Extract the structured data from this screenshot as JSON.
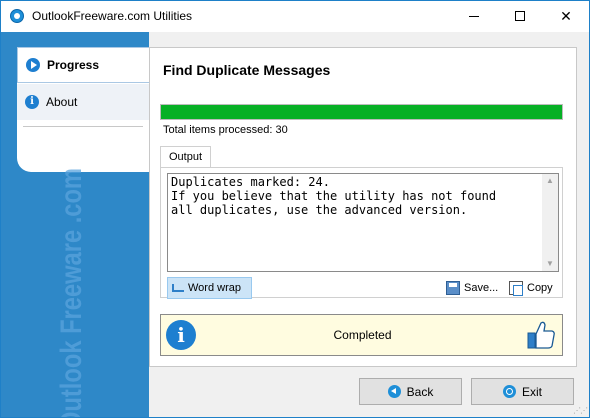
{
  "window": {
    "title": "OutlookFreeware.com Utilities"
  },
  "sidebar": {
    "items": [
      {
        "label": "Progress",
        "icon": "play-icon",
        "active": true
      },
      {
        "label": "About",
        "icon": "info-icon",
        "active": false
      }
    ],
    "watermark": "Outlook Freeware .com"
  },
  "main": {
    "title": "Find Duplicate Messages",
    "progress_percent": 100,
    "progress_color": "#06b025",
    "processed_text": "Total items processed: 30",
    "output_tab": "Output",
    "output_text": "Duplicates marked: 24.\nIf you believe that the utility has not found\nall duplicates, use the advanced version.",
    "toolbar": {
      "word_wrap": "Word wrap",
      "save": "Save...",
      "copy": "Copy"
    },
    "status": {
      "text": "Completed",
      "bg_color": "#fffce0"
    }
  },
  "footer": {
    "back": "Back",
    "exit": "Exit"
  }
}
